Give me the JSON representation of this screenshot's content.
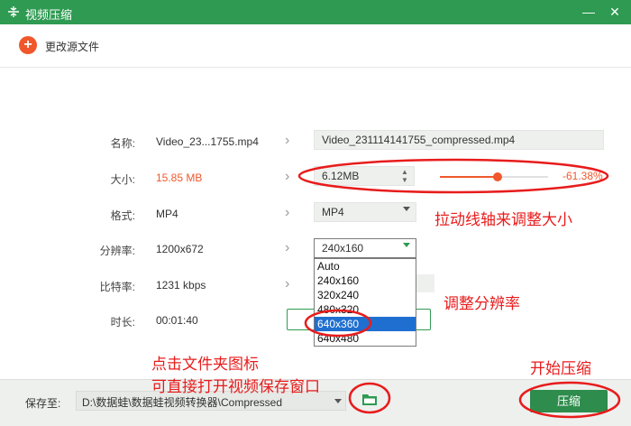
{
  "window": {
    "title": "视频压缩",
    "minimize_glyph": "—",
    "close_glyph": "✕"
  },
  "toolbar": {
    "change_source_label": "更改源文件"
  },
  "fields": {
    "name_label": "名称:",
    "name_value": "Video_23...1755.mp4",
    "name_output": "Video_231114141755_compressed.mp4",
    "size_label": "大小:",
    "size_value": "15.85 MB",
    "size_output": "6.12MB",
    "size_percent": "-61.38%",
    "size_slider_fraction": 0.53,
    "format_label": "格式:",
    "format_value": "MP4",
    "format_output": "MP4",
    "resolution_label": "分辨率:",
    "resolution_value": "1200x672",
    "resolution_output": "240x160",
    "bitrate_label": "比特率:",
    "bitrate_value": "1231 kbps",
    "duration_label": "时长:",
    "duration_value": "00:01:40"
  },
  "resolution_options": [
    "Auto",
    "240x160",
    "320x240",
    "480x320",
    "640x360",
    "640x480"
  ],
  "resolution_highlighted": "640x360",
  "footer": {
    "save_to_label": "保存至:",
    "save_path": "D:\\数据蛙\\数据蛙视频转换器\\Compressed",
    "compress_label": "压缩"
  },
  "annotations": {
    "slider_tip": "拉动线轴来调整大小",
    "resolution_tip": "调整分辨率",
    "folder_tip_line1": "点击文件夹图标",
    "folder_tip_line2": "可直接打开视频保存窗口",
    "start_tip": "开始压缩"
  },
  "colors": {
    "brand_green": "#2e9a52",
    "accent_orange": "#f0582b",
    "annotation_red": "#e81c1c",
    "highlight_blue": "#1f6fd0"
  },
  "icons": {
    "app": "compress-icon",
    "add": "plus-icon",
    "chevron": "chevron-right-icon",
    "folder": "folder-icon"
  }
}
